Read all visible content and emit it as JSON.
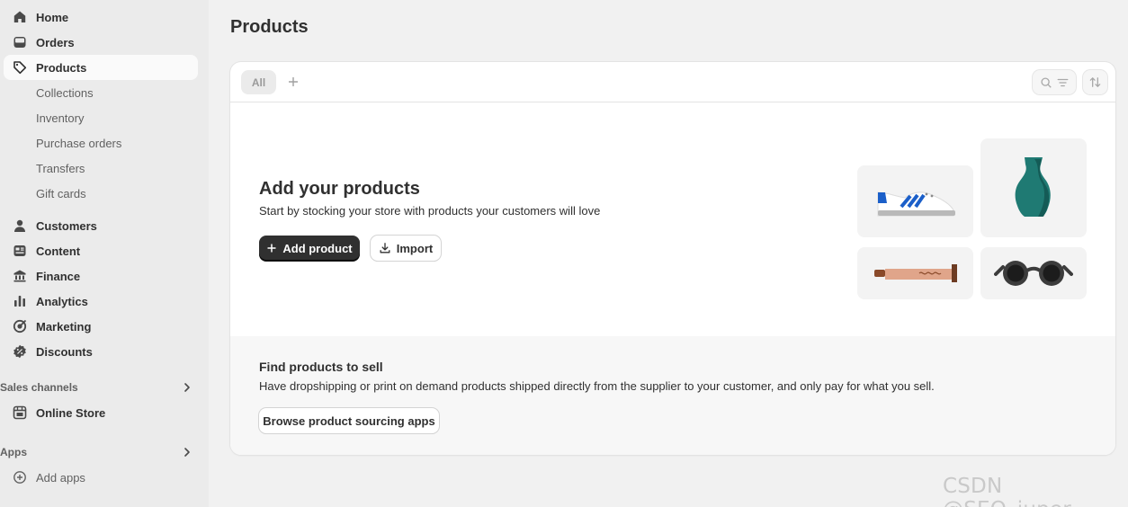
{
  "sidebar": {
    "items": [
      {
        "label": "Home",
        "icon": "home-icon"
      },
      {
        "label": "Orders",
        "icon": "inbox-icon"
      },
      {
        "label": "Products",
        "icon": "tag-icon",
        "active": true
      }
    ],
    "product_subitems": [
      "Collections",
      "Inventory",
      "Purchase orders",
      "Transfers",
      "Gift cards"
    ],
    "items2": [
      {
        "label": "Customers",
        "icon": "person-icon"
      },
      {
        "label": "Content",
        "icon": "content-icon"
      },
      {
        "label": "Finance",
        "icon": "bank-icon"
      },
      {
        "label": "Analytics",
        "icon": "bar-chart-icon"
      },
      {
        "label": "Marketing",
        "icon": "target-icon"
      },
      {
        "label": "Discounts",
        "icon": "discount-icon"
      }
    ],
    "sales_channels_label": "Sales channels",
    "online_store_label": "Online Store",
    "apps_label": "Apps",
    "add_apps_label": "Add apps"
  },
  "main": {
    "page_title": "Products",
    "tabs": {
      "all_label": "All"
    },
    "empty_state": {
      "title": "Add your products",
      "description": "Start by stocking your store with products your customers will love",
      "add_product_label": "Add product",
      "import_label": "Import"
    },
    "sourcing": {
      "title": "Find products to sell",
      "description": "Have dropshipping or print on demand products shipped directly from the supplier to your customer, and only pay for what you sell.",
      "button_label": "Browse product sourcing apps"
    }
  },
  "watermark": "CSDN @SEO_juper",
  "colors": {
    "sidebar_bg": "#ebebeb",
    "page_bg": "#f1f1f1",
    "primary_button": "#303030",
    "vase": "#1f7a73",
    "sneaker_stripe": "#1b5fc9"
  }
}
